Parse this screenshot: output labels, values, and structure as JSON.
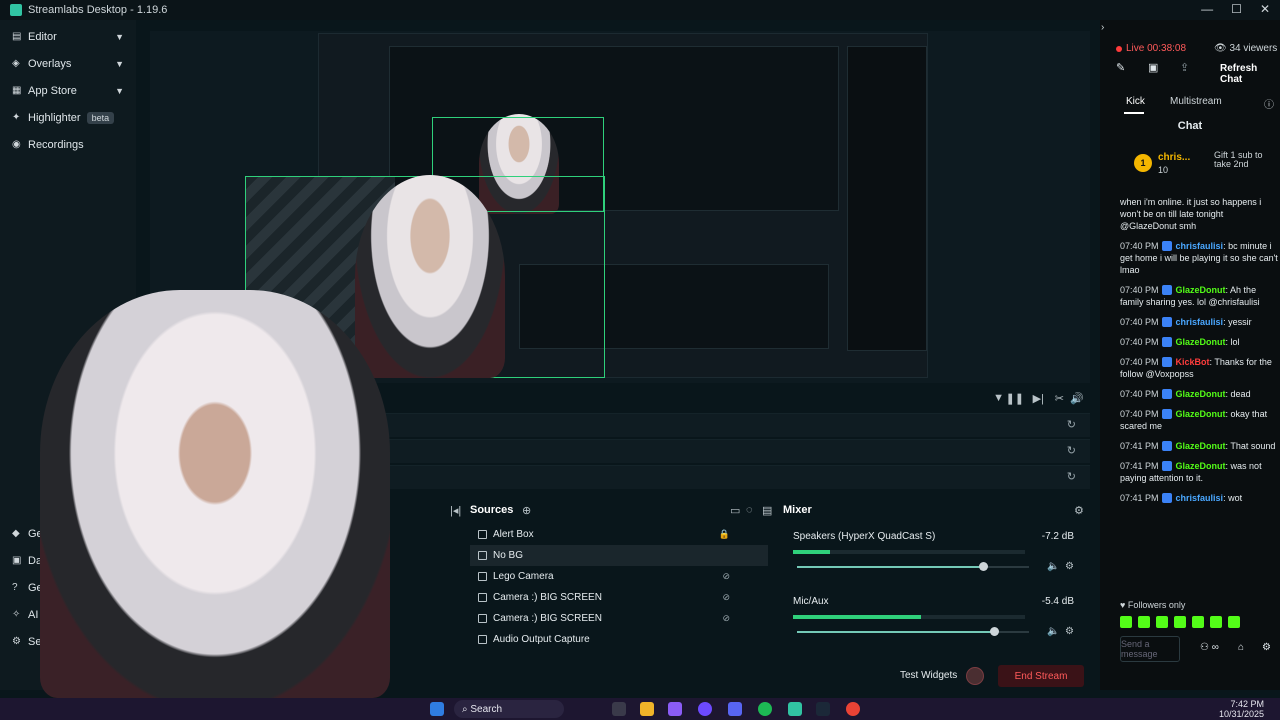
{
  "window": {
    "title": "Streamlabs Desktop - 1.19.6"
  },
  "sidebar": {
    "items": [
      {
        "label": "Editor",
        "icon": "editor-icon",
        "has_chevron": true
      },
      {
        "label": "Overlays",
        "icon": "overlays-icon",
        "has_chevron": true
      },
      {
        "label": "App Store",
        "icon": "store-icon",
        "has_chevron": true
      },
      {
        "label": "Highlighter",
        "icon": "highlighter-icon",
        "badge": "beta"
      },
      {
        "label": "Recordings",
        "icon": "recordings-icon"
      }
    ],
    "bottom_items": [
      {
        "label": "Get Ultra",
        "icon": "ultra-icon"
      },
      {
        "label": "Dashbo",
        "icon": "dashboard-icon"
      },
      {
        "label": "Get Help",
        "icon": "help-icon"
      },
      {
        "label": "AI",
        "icon": "ai-icon"
      },
      {
        "label": "Settin",
        "icon": "settings-icon"
      }
    ]
  },
  "sources": {
    "title": "Sources",
    "items": [
      {
        "label": "Alert Box",
        "right": "🔒"
      },
      {
        "label": "No BG",
        "right": ""
      },
      {
        "label": "Lego Camera",
        "right": "⊘"
      },
      {
        "label": "Camera :) BIG SCREEN",
        "right": "⊘"
      },
      {
        "label": "Camera :) BIG SCREEN",
        "right": "⊘"
      },
      {
        "label": "Audio Output Capture",
        "right": ""
      }
    ]
  },
  "mixer": {
    "title": "Mixer",
    "channels": [
      {
        "name": "Speakers (HyperX QuadCast S)",
        "db": "-7.2 dB",
        "level": 0.16,
        "volume": 0.8
      },
      {
        "name": "Mic/Aux",
        "db": "-5.4 dB",
        "level": 0.55,
        "volume": 0.85
      }
    ]
  },
  "footer": {
    "test_widgets": "Test Widgets",
    "rec": "REC",
    "end_stream": "End Stream"
  },
  "chat": {
    "live": "Live 00:38:08",
    "viewers": "34 viewers",
    "refresh": "Refresh Chat",
    "tabs": [
      "Kick",
      "Multistream"
    ],
    "title": "Chat",
    "pinned": {
      "user": "chris...",
      "count": "10",
      "text": "Gift 1 sub to take 2nd"
    },
    "first_text": "when i'm online. it just so happens i won't be on till late tonight @GlazeDonut smh",
    "messages": [
      {
        "time": "07:40 PM",
        "user": "chrisfaulisi",
        "cls": "u-chris",
        "text": "bc minute i get home i will be playing it so she can't lmao"
      },
      {
        "time": "07:40 PM",
        "user": "GlazeDonut",
        "cls": "u-glaze",
        "text": "Ah the family sharing yes. lol @chrisfaulisi"
      },
      {
        "time": "07:40 PM",
        "user": "chrisfaulisi",
        "cls": "u-chris",
        "text": "yessir"
      },
      {
        "time": "07:40 PM",
        "user": "GlazeDonut",
        "cls": "u-glaze",
        "text": "lol"
      },
      {
        "time": "07:40 PM",
        "user": "KickBot",
        "cls": "u-kick",
        "text": "Thanks for the follow @Voxpopss"
      },
      {
        "time": "07:40 PM",
        "user": "GlazeDonut",
        "cls": "u-glaze",
        "text": "dead"
      },
      {
        "time": "07:40 PM",
        "user": "GlazeDonut",
        "cls": "u-glaze",
        "text": "okay that scared me"
      },
      {
        "time": "07:41 PM",
        "user": "GlazeDonut",
        "cls": "u-glaze",
        "text": "That sound"
      },
      {
        "time": "07:41 PM",
        "user": "GlazeDonut",
        "cls": "u-glaze",
        "text": "was not paying attention to it."
      },
      {
        "time": "07:41 PM",
        "user": "chrisfaulisi",
        "cls": "u-chris",
        "text": "wot"
      }
    ],
    "followers_only": "Followers only",
    "send_placeholder": "Send a message"
  },
  "taskbar": {
    "search": "Search",
    "time": "7:42 PM",
    "date": "10/31/2025"
  },
  "colors": {
    "accent": "#31c3a2",
    "live": "#ff3b3b",
    "end_stream": "#ff5a5a",
    "kick_green": "#53fc18"
  }
}
